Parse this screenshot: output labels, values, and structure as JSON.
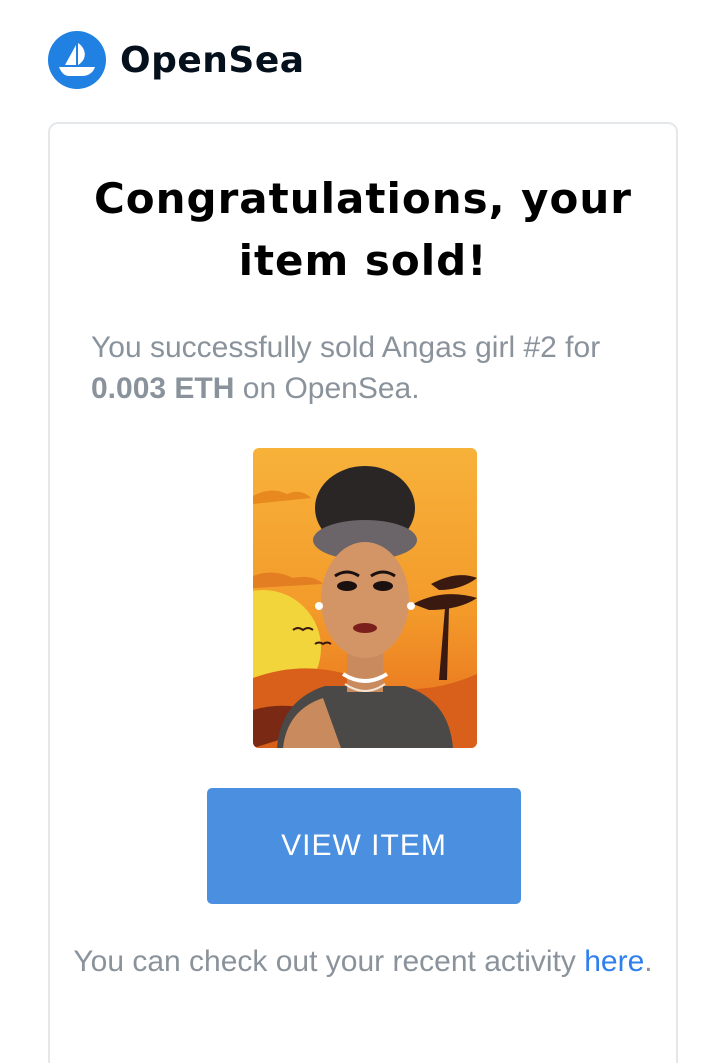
{
  "brand": {
    "name": "OpenSea",
    "logo_icon": "opensea-ship-icon",
    "logo_color": "#2081e2"
  },
  "email": {
    "headline": "Congratulations, your item sold!",
    "message": {
      "prefix": "You successfully sold Angas girl #2 for ",
      "price": "0.003 ETH",
      "suffix": " on OpenSea."
    },
    "item_image_icon": "nft-portrait-image",
    "view_button_label": "VIEW ITEM",
    "footer": {
      "text": "You can check out your recent activity ",
      "link_label": "here",
      "end": "."
    }
  },
  "colors": {
    "button": "#4a8fe0",
    "link": "#2f80ed",
    "muted_text": "#8a939b",
    "card_border": "#e5e8eb"
  }
}
